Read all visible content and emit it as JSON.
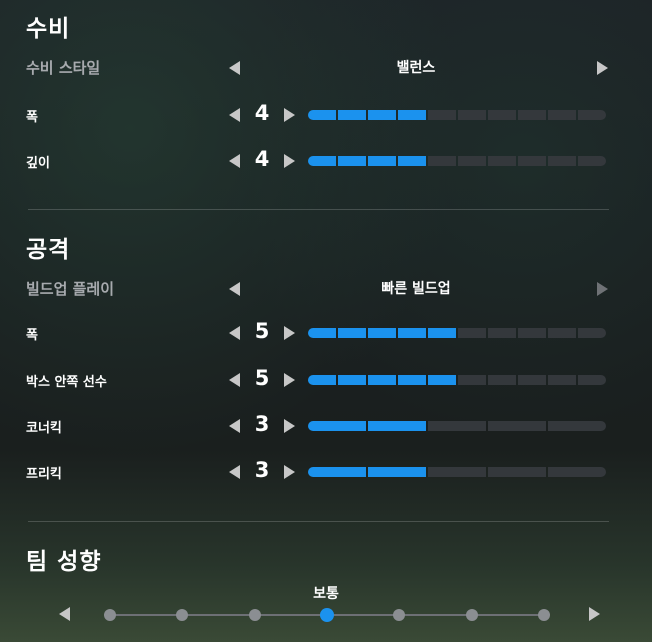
{
  "defense": {
    "title": "수비",
    "style_label": "수비 스타일",
    "style_value": "밸런스",
    "rows": [
      {
        "label": "폭",
        "value": "4",
        "level": 4,
        "segments": 10
      },
      {
        "label": "깊이",
        "value": "4",
        "level": 4,
        "segments": 10
      }
    ]
  },
  "attack": {
    "title": "공격",
    "style_label": "빌드업 플레이",
    "style_value": "빠른 빌드업",
    "rows": [
      {
        "label": "폭",
        "value": "5",
        "level": 5,
        "segments": 10
      },
      {
        "label": "박스 안쪽 선수",
        "value": "5",
        "level": 5,
        "segments": 10
      },
      {
        "label": "코너킥",
        "value": "3",
        "level": 3,
        "segments": 5
      },
      {
        "label": "프리킥",
        "value": "3",
        "level": 3,
        "segments": 5
      }
    ]
  },
  "tendency": {
    "title": "팀 성향",
    "value": "보통",
    "positions": 7,
    "selected_index": 3
  },
  "colors": {
    "accent": "#1b92ee",
    "inactive_segment": "#34383c"
  }
}
